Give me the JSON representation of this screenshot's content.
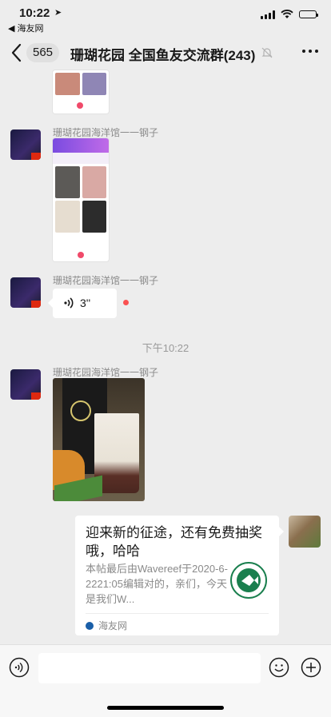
{
  "status": {
    "time": "10:22",
    "back_app": "◀ 海友网"
  },
  "header": {
    "unread_count": "565",
    "title": "珊瑚花园 全国鱼友交流群(243)"
  },
  "messages": {
    "sender_name": "珊瑚花园海洋馆一一钢子",
    "voice_duration": "3''",
    "timestamp": "下午10:22",
    "link_card": {
      "title": "迎来新的征途，还有免费抽奖哦，哈哈",
      "description": "本帖最后由Wavereef于2020-6-2221:05编辑对的，亲们，今天是我们W...",
      "source": "海友网"
    }
  },
  "input": {
    "placeholder": ""
  },
  "colors": {
    "background": "#ededed",
    "unread_dot": "#fa5151"
  }
}
